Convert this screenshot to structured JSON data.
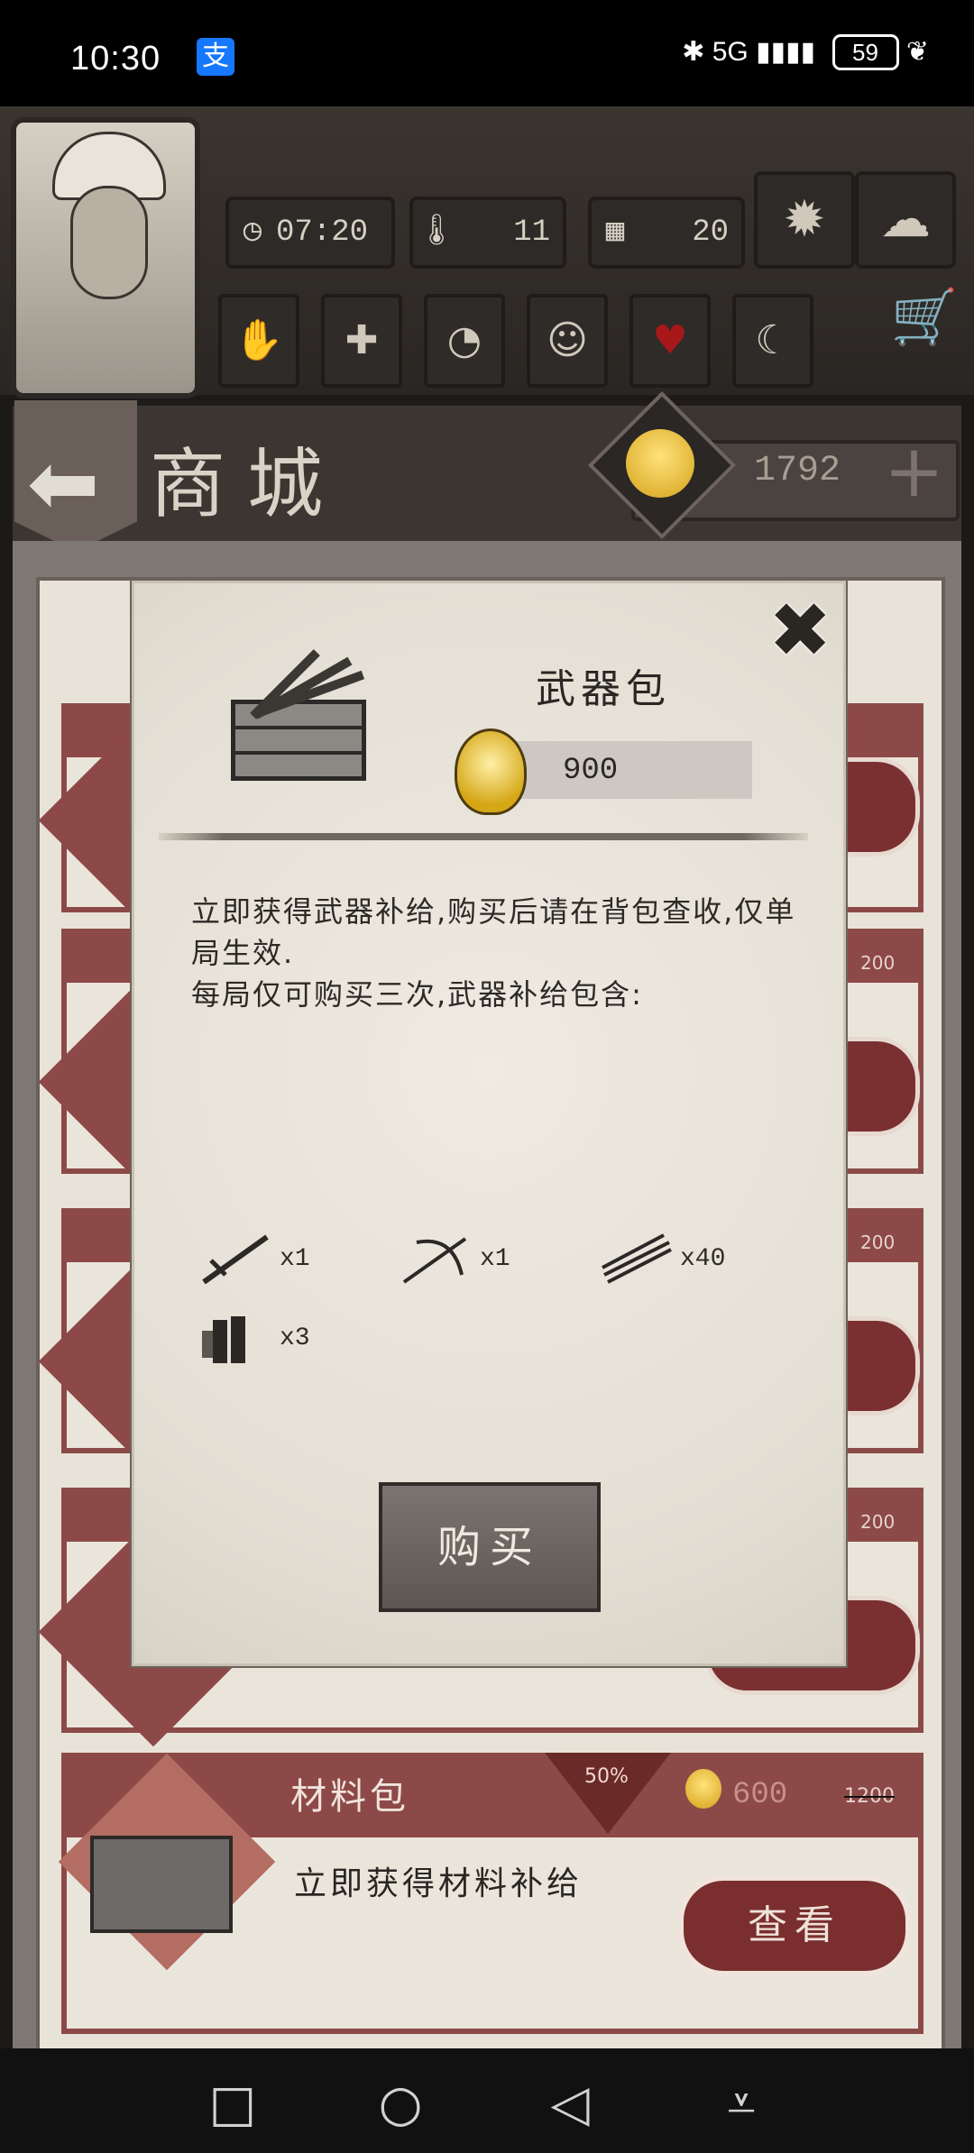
{
  "status_bar": {
    "time": "10:30",
    "alipay_badge": "支",
    "signal_text": "5G",
    "battery": "59"
  },
  "hud": {
    "clock": "07:20",
    "temperature": "11",
    "day": "20",
    "icons": [
      "clock-icon",
      "thermometer-icon",
      "calendar-icon",
      "leaf-icon",
      "storm-icon",
      "hand-icon",
      "plus-icon",
      "stomach-icon",
      "head-icon",
      "heart-icon",
      "moon-icon",
      "cart-icon"
    ]
  },
  "shop": {
    "title": "商城",
    "currency": "1792",
    "currency_plus": "+"
  },
  "background_card": {
    "name": "材料包",
    "discount": "50%",
    "price": "600",
    "old_price": "1200",
    "description": "立即获得材料补给",
    "view_label": "查看"
  },
  "background_old_prices": [
    "200",
    "200",
    "200"
  ],
  "modal": {
    "title": "武器包",
    "price": "900",
    "close_symbol": "✖",
    "description": "立即获得武器补给,购买后请在背包查收,仅单局生效.\n每局仅可购买三次,武器补给包含:",
    "rewards": [
      {
        "icon": "sword-icon",
        "qty": "x1"
      },
      {
        "icon": "crossbow-icon",
        "qty": "x1"
      },
      {
        "icon": "arrows-icon",
        "qty": "x40"
      },
      {
        "icon": "dynamite-icon",
        "qty": "x3"
      }
    ],
    "buy_label": "购买"
  },
  "nav": {
    "square": "□",
    "circle": "○",
    "back": "◁",
    "down": "⩡"
  },
  "colors": {
    "accent_red": "#8d4947",
    "parchment": "#e8e3d8",
    "gold": "#d4a21a"
  }
}
